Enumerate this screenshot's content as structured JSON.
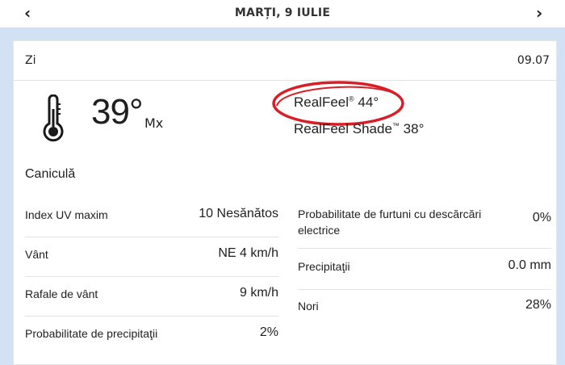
{
  "nav": {
    "prev_icon": "chevron-left-icon",
    "next_icon": "chevron-right-icon",
    "prev_glyph": "‹",
    "next_glyph": "›",
    "date_title": "MARȚI, 9 IULIE"
  },
  "panel": {
    "period_label": "Zi",
    "date_short": "09.07",
    "icon": "thermometer-icon",
    "temperature": "39°",
    "temperature_suffix": "Mx",
    "realfeel_label": "RealFeel",
    "realfeel_mark": "®",
    "realfeel_value": "44°",
    "realfeel_shade_label": "RealFeel Shade",
    "realfeel_shade_mark": "™",
    "realfeel_shade_value": "38°",
    "phrase": "Caniculă",
    "highlight_color": "#d81e26"
  },
  "details_left": [
    {
      "label": "Index UV maxim",
      "value": "10 Nesănătos"
    },
    {
      "label": "Vânt",
      "value": "NE 4 km/h"
    },
    {
      "label": "Rafale de vânt",
      "value": "9 km/h"
    },
    {
      "label": "Probabilitate de precipitaţii",
      "value": "2%"
    }
  ],
  "details_right": [
    {
      "label": "Probabilitate de furtuni cu descărcări electrice",
      "value": "0%"
    },
    {
      "label": "Precipitaţii",
      "value": "0.0 mm"
    },
    {
      "label": "Nori",
      "value": "28%"
    }
  ]
}
